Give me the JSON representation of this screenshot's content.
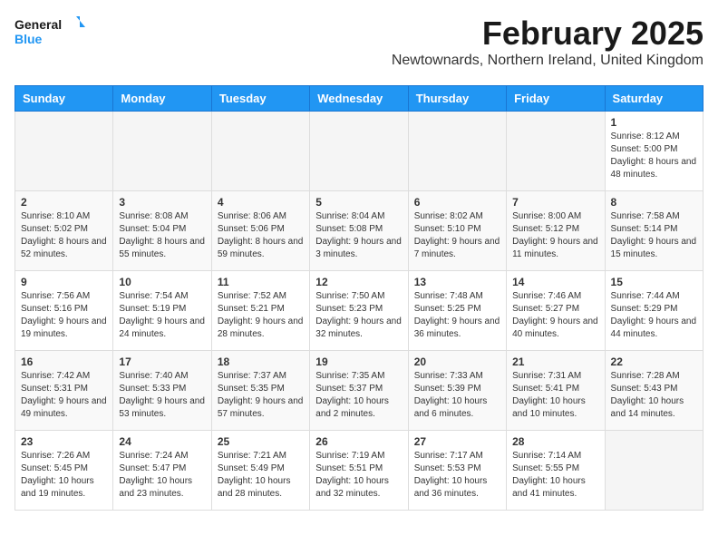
{
  "logo": {
    "line1": "General",
    "line2": "Blue"
  },
  "title": "February 2025",
  "subtitle": "Newtownards, Northern Ireland, United Kingdom",
  "days_of_week": [
    "Sunday",
    "Monday",
    "Tuesday",
    "Wednesday",
    "Thursday",
    "Friday",
    "Saturday"
  ],
  "weeks": [
    [
      {
        "day": "",
        "info": ""
      },
      {
        "day": "",
        "info": ""
      },
      {
        "day": "",
        "info": ""
      },
      {
        "day": "",
        "info": ""
      },
      {
        "day": "",
        "info": ""
      },
      {
        "day": "",
        "info": ""
      },
      {
        "day": "1",
        "info": "Sunrise: 8:12 AM\nSunset: 5:00 PM\nDaylight: 8 hours and 48 minutes."
      }
    ],
    [
      {
        "day": "2",
        "info": "Sunrise: 8:10 AM\nSunset: 5:02 PM\nDaylight: 8 hours and 52 minutes."
      },
      {
        "day": "3",
        "info": "Sunrise: 8:08 AM\nSunset: 5:04 PM\nDaylight: 8 hours and 55 minutes."
      },
      {
        "day": "4",
        "info": "Sunrise: 8:06 AM\nSunset: 5:06 PM\nDaylight: 8 hours and 59 minutes."
      },
      {
        "day": "5",
        "info": "Sunrise: 8:04 AM\nSunset: 5:08 PM\nDaylight: 9 hours and 3 minutes."
      },
      {
        "day": "6",
        "info": "Sunrise: 8:02 AM\nSunset: 5:10 PM\nDaylight: 9 hours and 7 minutes."
      },
      {
        "day": "7",
        "info": "Sunrise: 8:00 AM\nSunset: 5:12 PM\nDaylight: 9 hours and 11 minutes."
      },
      {
        "day": "8",
        "info": "Sunrise: 7:58 AM\nSunset: 5:14 PM\nDaylight: 9 hours and 15 minutes."
      }
    ],
    [
      {
        "day": "9",
        "info": "Sunrise: 7:56 AM\nSunset: 5:16 PM\nDaylight: 9 hours and 19 minutes."
      },
      {
        "day": "10",
        "info": "Sunrise: 7:54 AM\nSunset: 5:19 PM\nDaylight: 9 hours and 24 minutes."
      },
      {
        "day": "11",
        "info": "Sunrise: 7:52 AM\nSunset: 5:21 PM\nDaylight: 9 hours and 28 minutes."
      },
      {
        "day": "12",
        "info": "Sunrise: 7:50 AM\nSunset: 5:23 PM\nDaylight: 9 hours and 32 minutes."
      },
      {
        "day": "13",
        "info": "Sunrise: 7:48 AM\nSunset: 5:25 PM\nDaylight: 9 hours and 36 minutes."
      },
      {
        "day": "14",
        "info": "Sunrise: 7:46 AM\nSunset: 5:27 PM\nDaylight: 9 hours and 40 minutes."
      },
      {
        "day": "15",
        "info": "Sunrise: 7:44 AM\nSunset: 5:29 PM\nDaylight: 9 hours and 44 minutes."
      }
    ],
    [
      {
        "day": "16",
        "info": "Sunrise: 7:42 AM\nSunset: 5:31 PM\nDaylight: 9 hours and 49 minutes."
      },
      {
        "day": "17",
        "info": "Sunrise: 7:40 AM\nSunset: 5:33 PM\nDaylight: 9 hours and 53 minutes."
      },
      {
        "day": "18",
        "info": "Sunrise: 7:37 AM\nSunset: 5:35 PM\nDaylight: 9 hours and 57 minutes."
      },
      {
        "day": "19",
        "info": "Sunrise: 7:35 AM\nSunset: 5:37 PM\nDaylight: 10 hours and 2 minutes."
      },
      {
        "day": "20",
        "info": "Sunrise: 7:33 AM\nSunset: 5:39 PM\nDaylight: 10 hours and 6 minutes."
      },
      {
        "day": "21",
        "info": "Sunrise: 7:31 AM\nSunset: 5:41 PM\nDaylight: 10 hours and 10 minutes."
      },
      {
        "day": "22",
        "info": "Sunrise: 7:28 AM\nSunset: 5:43 PM\nDaylight: 10 hours and 14 minutes."
      }
    ],
    [
      {
        "day": "23",
        "info": "Sunrise: 7:26 AM\nSunset: 5:45 PM\nDaylight: 10 hours and 19 minutes."
      },
      {
        "day": "24",
        "info": "Sunrise: 7:24 AM\nSunset: 5:47 PM\nDaylight: 10 hours and 23 minutes."
      },
      {
        "day": "25",
        "info": "Sunrise: 7:21 AM\nSunset: 5:49 PM\nDaylight: 10 hours and 28 minutes."
      },
      {
        "day": "26",
        "info": "Sunrise: 7:19 AM\nSunset: 5:51 PM\nDaylight: 10 hours and 32 minutes."
      },
      {
        "day": "27",
        "info": "Sunrise: 7:17 AM\nSunset: 5:53 PM\nDaylight: 10 hours and 36 minutes."
      },
      {
        "day": "28",
        "info": "Sunrise: 7:14 AM\nSunset: 5:55 PM\nDaylight: 10 hours and 41 minutes."
      },
      {
        "day": "",
        "info": ""
      }
    ]
  ]
}
